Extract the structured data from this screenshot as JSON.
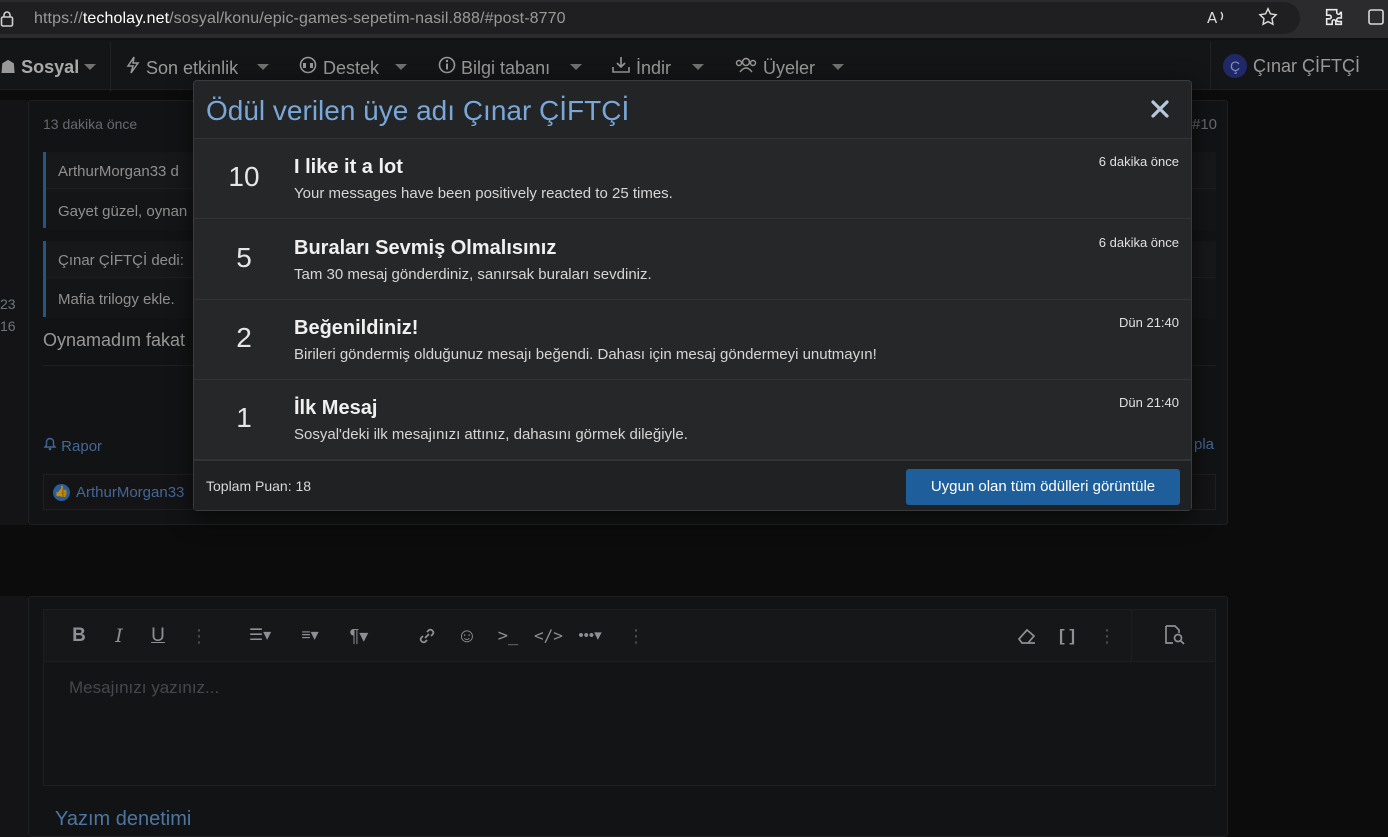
{
  "browser": {
    "url_prefix": "https://",
    "url_host": "techolay.net",
    "url_path": "/sosyal/konu/epic-games-sepetim-nasil.888/#post-8770",
    "icons": [
      "lock-icon",
      "read-aloud-icon",
      "favorite-star-icon",
      "extensions-icon",
      "more-icon"
    ]
  },
  "nav": {
    "brand": "Sosyal",
    "items": [
      {
        "label": "Son etkinlik",
        "icon": "lightning-icon"
      },
      {
        "label": "Destek",
        "icon": "headset-icon"
      },
      {
        "label": "Bilgi tabanı",
        "icon": "info-icon"
      },
      {
        "label": "İndir",
        "icon": "download-icon"
      },
      {
        "label": "Üyeler",
        "icon": "users-icon"
      }
    ],
    "user": {
      "avatar_letter": "Ç",
      "name": "Çınar ÇİFTÇİ"
    }
  },
  "post": {
    "time": "13 dakika önce",
    "id": "#10",
    "side_numbers": [
      "23",
      "16"
    ],
    "quote1_author": "ArthurMorgan33 d",
    "quote1_text": "Gayet güzel, oynan",
    "quote2_author": "Çınar ÇİFTÇİ dedi:",
    "quote2_text": "Mafia trilogy ekle.",
    "text": "Oynamadım fakat",
    "report_label": "Rapor",
    "reply_label": "pla",
    "reaction_user": "ArthurMorgan33"
  },
  "editor": {
    "placeholder": "Mesajınızı yazınız...",
    "spellcheck_label": "Yazım denetimi",
    "toolbar": [
      "bold-icon",
      "italic-icon",
      "underline-icon",
      "more-vertical-icon",
      "list-icon",
      "align-icon",
      "paragraph-icon",
      "link-icon",
      "smiley-icon",
      "terminal-icon",
      "code-icon",
      "more-horizontal-icon",
      "clear-format-icon",
      "bbcode-icon",
      "preview-icon"
    ]
  },
  "modal": {
    "title": "Ödül verilen üye adı Çınar ÇİFTÇİ",
    "close_label": "✕",
    "trophies": [
      {
        "points": "10",
        "title": "I like it a lot",
        "description": "Your messages have been positively reacted to 25 times.",
        "time": "6 dakika önce"
      },
      {
        "points": "5",
        "title": "Buraları Sevmiş Olmalısınız",
        "description": "Tam 30 mesaj gönderdiniz, sanırsak buraları sevdiniz.",
        "time": "6 dakika önce"
      },
      {
        "points": "2",
        "title": "Beğenildiniz!",
        "description": "Birileri göndermiş olduğunuz mesajı beğendi. Dahası için mesaj göndermeyi unutmayın!",
        "time": "Dün 21:40"
      },
      {
        "points": "1",
        "title": "İlk Mesaj",
        "description": "Sosyal'deki ilk mesajınızı attınız, dahasını görmek dileğiyle.",
        "time": "Dün 21:40"
      }
    ],
    "total_points": "Toplam Puan: 18",
    "view_all_label": "Uygun olan tüm ödülleri görüntüle"
  },
  "colors": {
    "accent": "#1e5f9b",
    "link": "#5d8fcf",
    "title": "#79a7d8",
    "background": "#111112"
  }
}
